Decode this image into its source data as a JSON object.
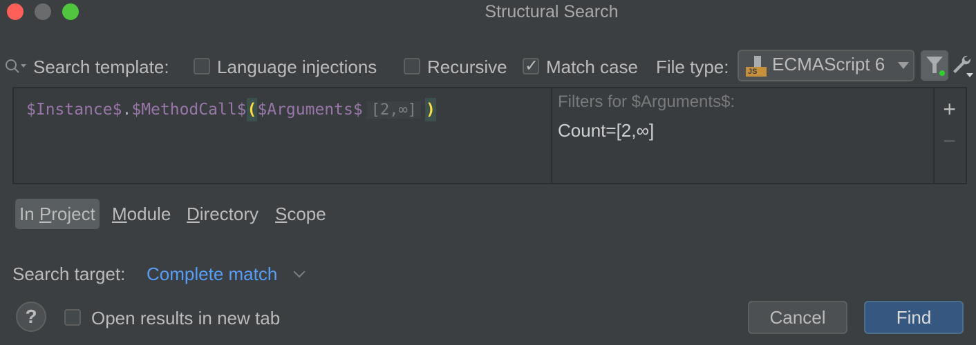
{
  "window": {
    "title": "Structural Search"
  },
  "toolbar": {
    "search_template_label": "Search template:",
    "language_injections": {
      "label": "Language injections",
      "checked": false
    },
    "recursive": {
      "label": "Recursive",
      "checked": false
    },
    "match_case": {
      "label": "Match case",
      "checked": true
    },
    "file_type_label": "File type:",
    "file_type_value": "ECMAScript 6",
    "file_type_badge": "JS"
  },
  "editor": {
    "tokens": {
      "instance": "$Instance$",
      "dot": ".",
      "method": "$MethodCall$",
      "open_paren": "(",
      "arguments": "$Arguments$",
      "inlay": "[2,∞]",
      "close_paren": ")"
    }
  },
  "filters": {
    "header": "Filters for $Arguments$:",
    "value": "Count=[2,∞]",
    "add_label": "+",
    "remove_label": "−"
  },
  "scope": {
    "items": [
      {
        "pre": "In ",
        "mnemonic": "P",
        "post": "roject",
        "selected": true
      },
      {
        "pre": "",
        "mnemonic": "M",
        "post": "odule",
        "selected": false
      },
      {
        "pre": "",
        "mnemonic": "D",
        "post": "irectory",
        "selected": false
      },
      {
        "pre": "",
        "mnemonic": "S",
        "post": "cope",
        "selected": false
      }
    ]
  },
  "search_target": {
    "label": "Search target:",
    "value": "Complete match"
  },
  "footer": {
    "help_label": "?",
    "open_new_tab": {
      "label": "Open results in new tab",
      "checked": false
    },
    "cancel_label": "Cancel",
    "find_label": "Find"
  },
  "colors": {
    "accent": "#365880",
    "link": "#589df6",
    "background": "#3c3f41"
  }
}
